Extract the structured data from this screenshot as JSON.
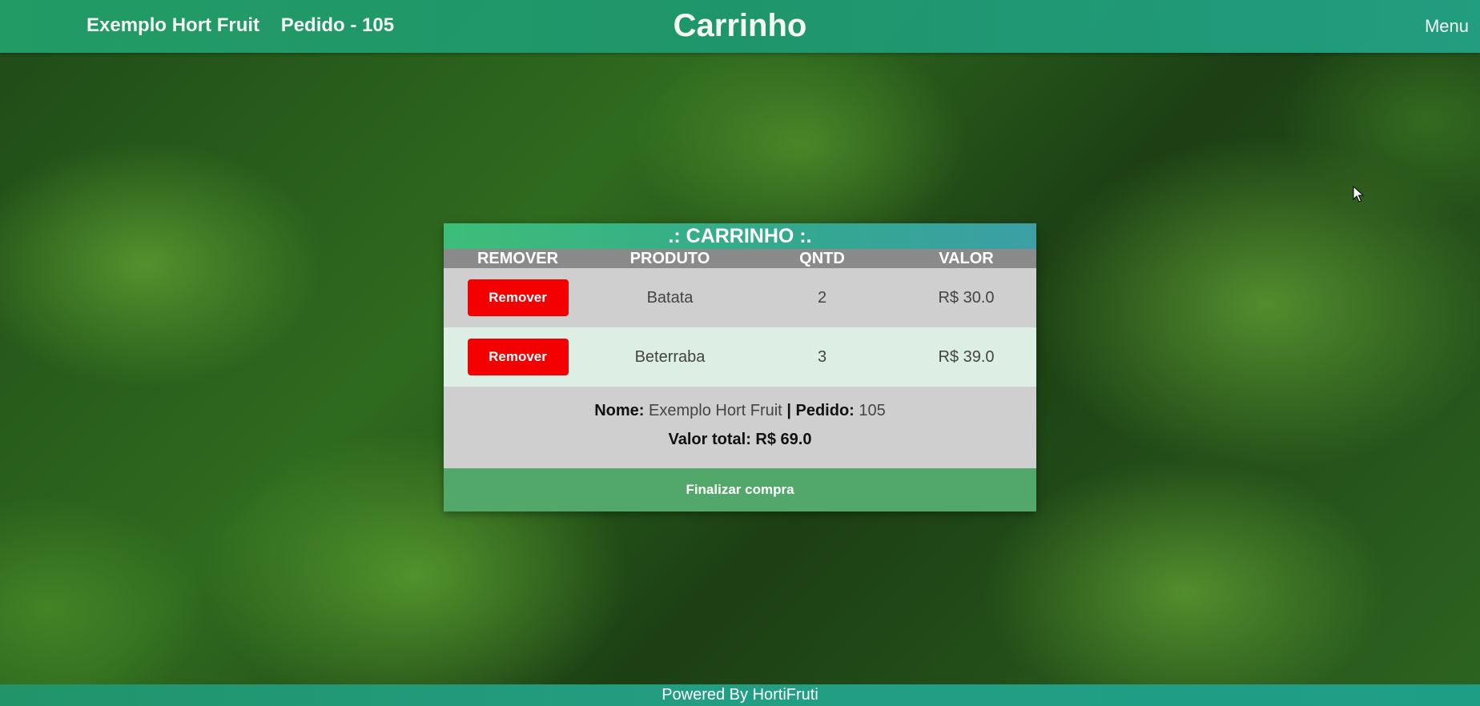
{
  "header": {
    "brand_name": "Exemplo Hort Fruit",
    "order_label": "Pedido - 105",
    "title": "Carrinho",
    "menu_label": "Menu"
  },
  "cart": {
    "title": ".: CARRINHO :.",
    "columns": [
      "REMOVER",
      "PRODUTO",
      "QNTD",
      "VALOR"
    ],
    "items": [
      {
        "remove_label": "Remover",
        "product": "Batata",
        "quantity": "2",
        "value": "R$ 30.0"
      },
      {
        "remove_label": "Remover",
        "product": "Beterraba",
        "quantity": "3",
        "value": "R$ 39.0"
      }
    ],
    "summary": {
      "name_label": "Nome:",
      "name_value": "Exemplo Hort Fruit",
      "separator": "|",
      "order_label": "Pedido:",
      "order_value": "105",
      "total_label": "Valor total:",
      "total_value": "R$ 69.0"
    },
    "finalize_label": "Finalizar compra"
  },
  "footer": {
    "text": "Powered By HortiFruti"
  },
  "colors": {
    "header_bg": "#1f9870",
    "remove_button": "#f50000",
    "finalize_button": "#52a86b",
    "table_head": "#8a8a8a"
  },
  "icons": {
    "cursor": "mouse-pointer-icon"
  }
}
